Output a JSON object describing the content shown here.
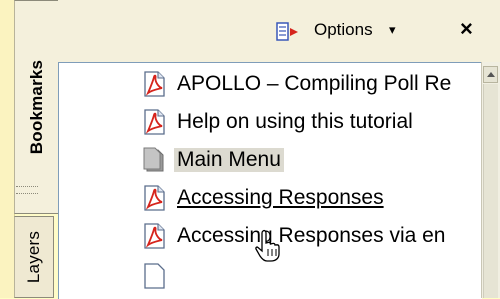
{
  "tabs": {
    "bookmarks_label": "Bookmarks",
    "layers_label": "Layers"
  },
  "header": {
    "options_label": "Options",
    "caret": "▾",
    "close_label": "×"
  },
  "bookmarks": [
    {
      "label": "APOLLO – Compiling Poll Re",
      "icon": "pdf-bookmark-icon"
    },
    {
      "label": "Help on using this tutorial",
      "icon": "pdf-bookmark-icon"
    },
    {
      "label": "Main Menu",
      "icon": "gray-bookmark-icon",
      "selected": true
    },
    {
      "label": "Accessing Responses",
      "icon": "pdf-bookmark-icon",
      "hovered": true
    },
    {
      "label": "Accessing Responses via en",
      "icon": "pdf-bookmark-icon"
    }
  ],
  "colors": {
    "pdf_red": "#d6241c",
    "panel_bg": "#fffcc8"
  }
}
